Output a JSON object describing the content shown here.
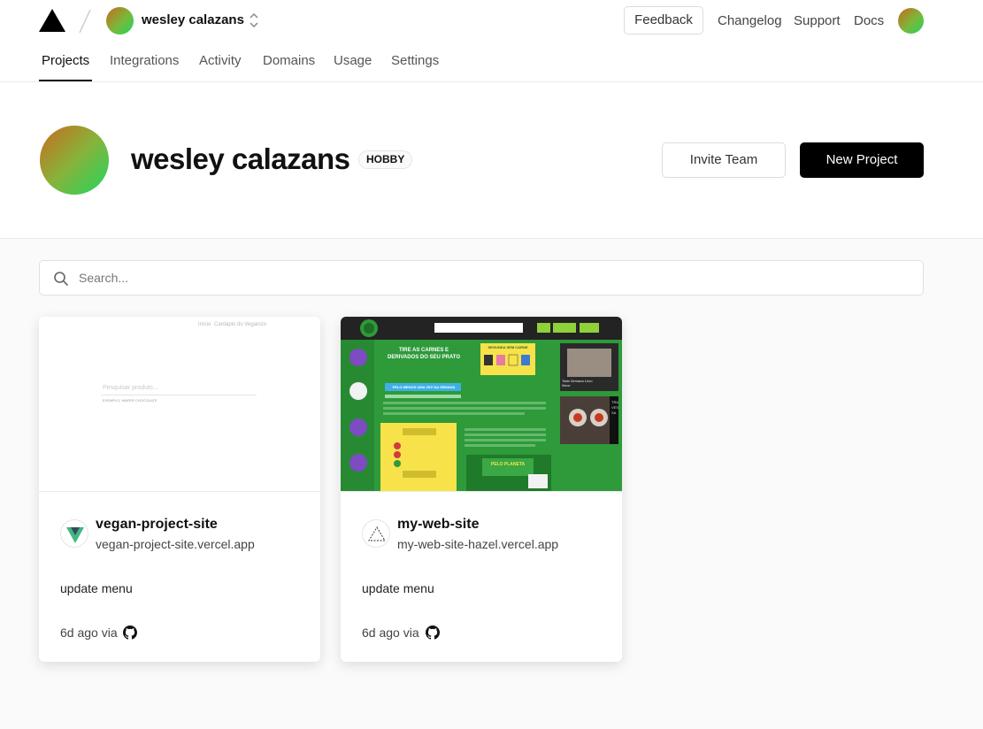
{
  "header": {
    "team_name": "wesley calazans",
    "feedback_label": "Feedback",
    "links": [
      "Changelog",
      "Support",
      "Docs"
    ]
  },
  "tabs": [
    "Projects",
    "Integrations",
    "Activity",
    "Domains",
    "Usage",
    "Settings"
  ],
  "hero": {
    "name": "wesley calazans",
    "plan_badge": "HOBBY",
    "invite_label": "Invite Team",
    "new_project_label": "New Project"
  },
  "search": {
    "placeholder": "Search..."
  },
  "projects": [
    {
      "name": "vegan-project-site",
      "url": "vegan-project-site.vercel.app",
      "commit": "update menu",
      "meta": "6d ago via",
      "icon": "vue-icon"
    },
    {
      "name": "my-web-site",
      "url": "my-web-site-hazel.vercel.app",
      "commit": "update menu",
      "meta": "6d ago via",
      "icon": "triangle-icon"
    }
  ],
  "preview_vegan": {
    "search_placeholder": "Pesquisar produto...",
    "example": "EXEMPLO: WAFER CHOCOLATE",
    "nav": [
      "Início",
      "Cardápio do Veganizo"
    ]
  },
  "preview_mysite": {
    "headline": "TIRE AS CARNES E DERIVADOS DO SEU PRATO",
    "button": "PELO MENOS UMA VEZ NA SEMANA",
    "side_title": "SEGUNDA SEM CARNE",
    "planet": "PELO PLANETA",
    "book": "Toda Semana Livro Novo",
    "vertical": "TRAVESSA"
  },
  "colors": {
    "accent_black": "#000000",
    "avatar_gradient_start": "#c96a1e",
    "avatar_gradient_end": "#1fd65f",
    "site_green": "#2e9a3a"
  }
}
